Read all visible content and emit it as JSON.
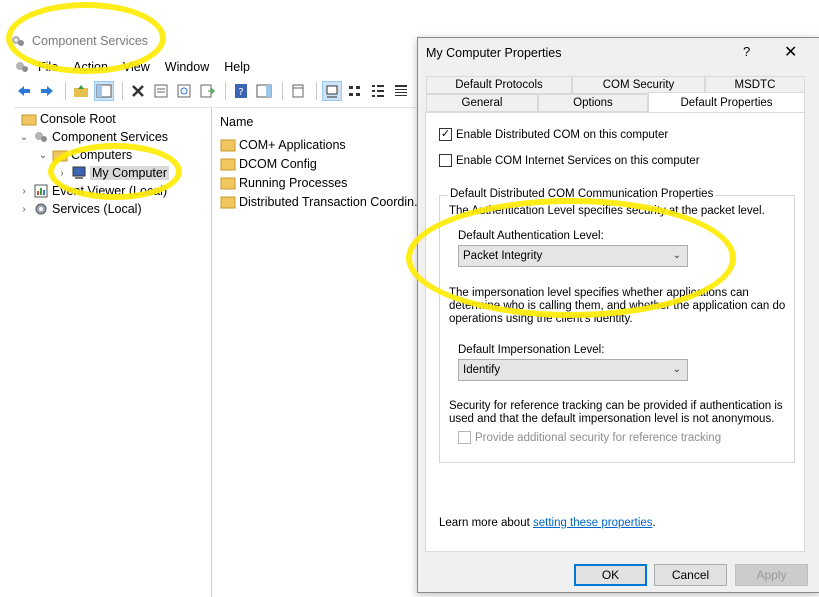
{
  "window": {
    "title": "Component Services"
  },
  "menu": [
    "File",
    "Action",
    "View",
    "Window",
    "Help"
  ],
  "tree": [
    {
      "label": "Console Root",
      "icon": "folder-icon"
    },
    {
      "label": "Component Services",
      "icon": "component-services-icon"
    },
    {
      "label": "Computers",
      "icon": "folder-icon"
    },
    {
      "label": "My Computer",
      "icon": "computer-icon"
    },
    {
      "label": "Event Viewer (Local)",
      "icon": "event-viewer-icon"
    },
    {
      "label": "Services (Local)",
      "icon": "services-icon"
    }
  ],
  "list": {
    "header": "Name",
    "items": [
      "COM+ Applications",
      "DCOM Config",
      "Running Processes",
      "Distributed Transaction Coordin..."
    ]
  },
  "dialog": {
    "title": "My Computer Properties",
    "help": "?",
    "close": "✕",
    "tabs_row1": [
      "Default Protocols",
      "COM Security",
      "MSDTC"
    ],
    "tabs_row2": [
      "General",
      "Options",
      "Default Properties"
    ],
    "enable_dcom": {
      "label": "Enable Distributed COM on this computer",
      "checked": true
    },
    "enable_internet": {
      "label": "Enable COM Internet Services on this computer",
      "checked": false
    },
    "group_title": "Default Distributed COM Communication Properties",
    "auth_desc": "The Authentication Level specifies security at the packet level.",
    "auth_label": "Default Authentication Level:",
    "auth_value": "Packet Integrity",
    "imp_desc": "The impersonation level specifies whether applications can determine who is calling them, and whether the application can do operations using the client's identity.",
    "imp_label": "Default Impersonation Level:",
    "imp_value": "Identify",
    "ref_desc": "Security for reference tracking can be provided if authentication is used and that the default impersonation level is not anonymous.",
    "ref_checkbox": {
      "label": "Provide additional security for reference tracking",
      "checked": false
    },
    "learn_prefix": "Learn more about ",
    "learn_link": "setting these properties",
    "learn_suffix": ".",
    "buttons": {
      "ok": "OK",
      "cancel": "Cancel",
      "apply": "Apply"
    }
  },
  "colors": {
    "highlight": "#ffeb00",
    "accent": "#0078d7",
    "link": "#0066cc"
  }
}
